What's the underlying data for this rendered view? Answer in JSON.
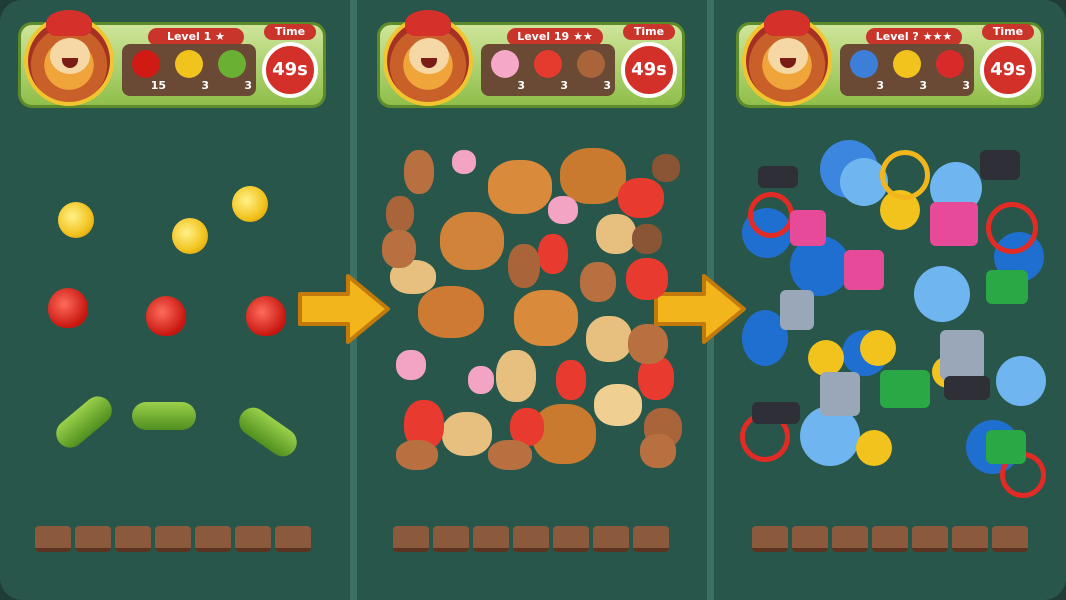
{
  "panels": [
    {
      "level_label": "Level 1",
      "stars": 1,
      "time_label": "Time",
      "time_value": "49s",
      "goals": [
        {
          "icon": "strawberry-icon",
          "count": "15",
          "color": "#d01a14"
        },
        {
          "icon": "duck-icon",
          "count": "3",
          "color": "#f2c21d"
        },
        {
          "icon": "plane-icon",
          "count": "3",
          "color": "#6ab032"
        }
      ]
    },
    {
      "level_label": "Level 19",
      "stars": 2,
      "time_label": "Time",
      "time_value": "49s",
      "goals": [
        {
          "icon": "ice-cream-icon",
          "count": "3",
          "color": "#f6a8c8"
        },
        {
          "icon": "fries-icon",
          "count": "3",
          "color": "#e53b2f"
        },
        {
          "icon": "cone-icon",
          "count": "3",
          "color": "#a9643a"
        }
      ]
    },
    {
      "level_label": "Level ?",
      "stars": 3,
      "time_label": "Time",
      "time_value": "49s",
      "goals": [
        {
          "icon": "bell-icon",
          "count": "3",
          "color": "#3d7fd8"
        },
        {
          "icon": "duck-icon",
          "count": "3",
          "color": "#f2c21d"
        },
        {
          "icon": "macaron-icon",
          "count": "3",
          "color": "#d92a2a"
        }
      ]
    }
  ],
  "tray_slots": 7,
  "colors": {
    "panel_bg": "#28564b",
    "hud_green": "#8fbf4a",
    "accent_red": "#c9342b",
    "arrow": "#f2b51c"
  }
}
